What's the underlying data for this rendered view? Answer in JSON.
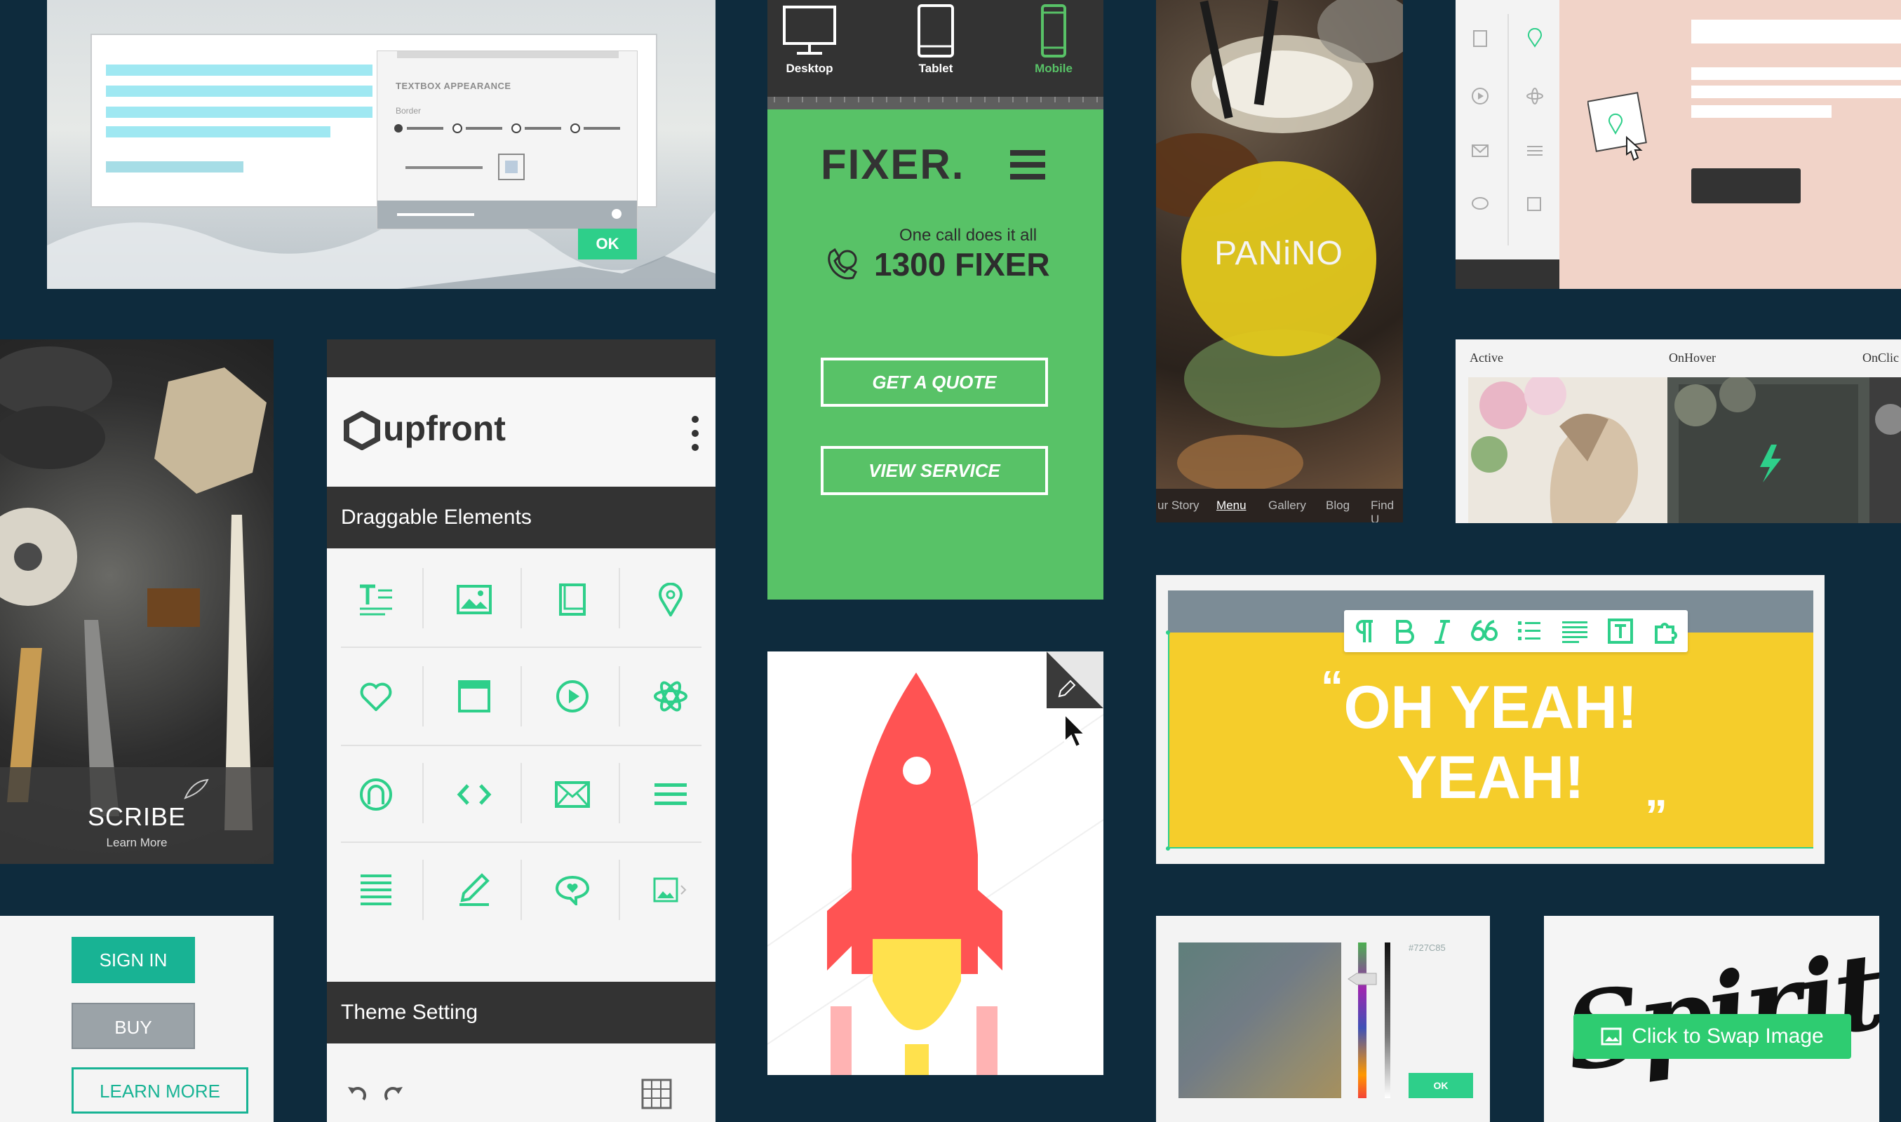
{
  "colors": {
    "background": "#0e2b3d",
    "accent_green": "#2ecf8a",
    "fixer_green": "#58c267",
    "yellow": "#f5cd2b",
    "rocket_red": "#ff5353"
  },
  "textbox_dialog": {
    "heading": "TEXTBOX APPEARANCE",
    "border_label": "Border",
    "ok_label": "OK"
  },
  "device_switcher": {
    "items": [
      {
        "label": "Desktop",
        "icon": "desktop-icon",
        "active": false
      },
      {
        "label": "Tablet",
        "icon": "tablet-icon",
        "active": false
      },
      {
        "label": "Mobile",
        "icon": "mobile-icon",
        "active": true
      }
    ]
  },
  "fixer": {
    "logo": "FIXER.",
    "tagline": "One call does it all",
    "phone": "1300 FIXER",
    "buttons": [
      "GET A QUOTE",
      "VIEW SERVICE"
    ]
  },
  "panino": {
    "title": "PANiNO",
    "nav": [
      "ur Story",
      "Menu",
      "Gallery",
      "Blog",
      "Find U"
    ],
    "active_nav": "Menu"
  },
  "scribe": {
    "title": "SCRIBE",
    "subtitle": "Learn More"
  },
  "upfront": {
    "logo": "upfront",
    "draggable_title": "Draggable Elements",
    "theme_title": "Theme Setting",
    "elements": [
      "text-icon",
      "image-icon",
      "book-icon",
      "map-pin-icon",
      "heart-icon",
      "frame-icon",
      "play-icon",
      "atom-icon",
      "ring-icon",
      "code-icon",
      "mail-icon",
      "menu-icon",
      "text-block-icon",
      "pencil-icon",
      "comment-icon",
      "slider-image-icon"
    ]
  },
  "hover_states": {
    "labels": [
      "Active",
      "OnHover",
      "OnClic"
    ]
  },
  "quote_block": {
    "line1": "OH YEAH!",
    "line2": "YEAH!",
    "open_quote": "“",
    "close_quote": "„",
    "toolbar": [
      "paragraph-icon",
      "bold-icon",
      "italic-icon",
      "quote-icon",
      "list-icon",
      "align-icon",
      "text-icon",
      "puzzle-icon"
    ]
  },
  "buttons_demo": {
    "sign_in": "SIGN IN",
    "buy": "BUY",
    "learn_more": "LEARN MORE"
  },
  "color_picker": {
    "hex": "#727C85",
    "ok": "OK"
  },
  "spirit": {
    "swap_label": "Click to Swap Image",
    "script_text": "Spirit"
  }
}
